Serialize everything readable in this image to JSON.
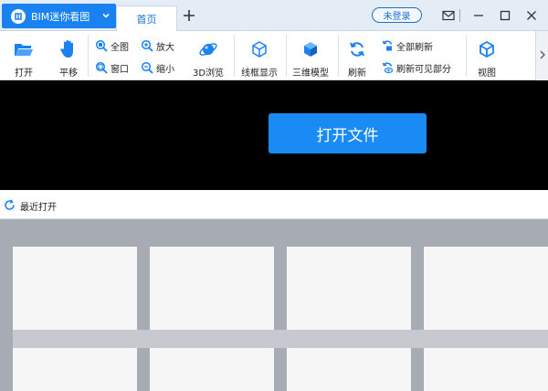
{
  "titlebar": {
    "app_name": "BIM迷你看图",
    "tab_home": "首页",
    "login_label": "未登录"
  },
  "ribbon": {
    "open": "打开",
    "pan": "平移",
    "fit_all": "全图",
    "window_zoom": "窗口",
    "zoom_in": "放大",
    "zoom_out": "缩小",
    "browse_3d": "3D浏览",
    "wireframe": "线框显示",
    "model_3d": "三维模型",
    "refresh": "刷新",
    "refresh_all": "全部刷新",
    "refresh_visible": "刷新可见部分",
    "view": "视图"
  },
  "banner": {
    "open_file": "打开文件"
  },
  "recent": {
    "label": "最近打开"
  },
  "colors": {
    "accent": "#1a82f0",
    "banner_bg": "#000000",
    "grid_bg": "#a7abb3"
  }
}
